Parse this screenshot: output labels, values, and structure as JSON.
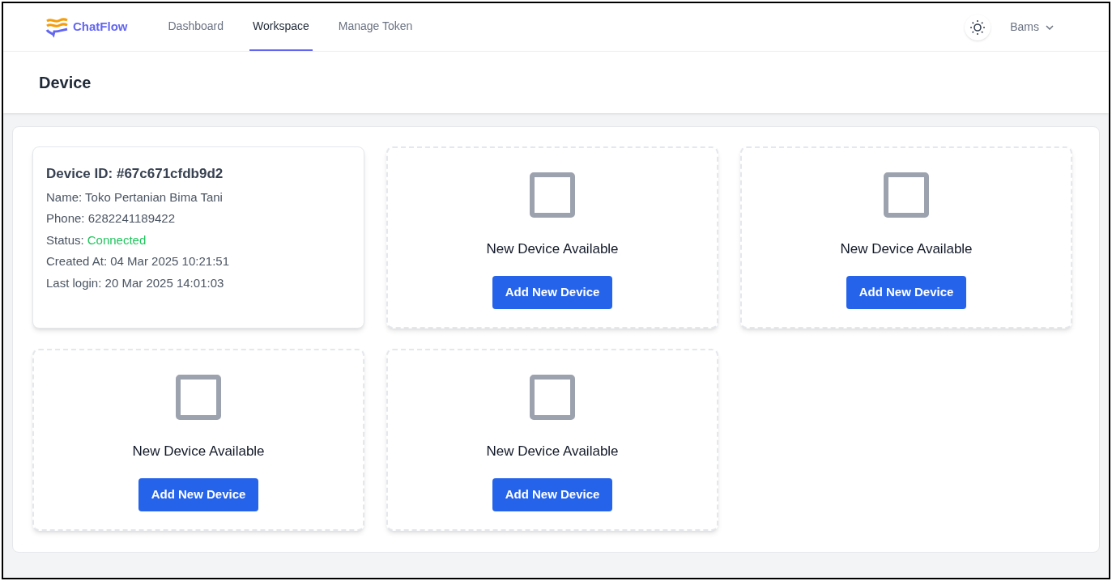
{
  "nav": {
    "brand": "ChatFlow",
    "links": [
      {
        "label": "Dashboard",
        "selected": false
      },
      {
        "label": "Workspace",
        "selected": true
      },
      {
        "label": "Manage Token",
        "selected": false
      }
    ],
    "user": "Bams"
  },
  "page_title": "Device",
  "devices": [
    {
      "kind": "device",
      "title": "Device ID: #67c671cfdb9d2",
      "lines": [
        "Name: Toko Pertanian Bima Tani",
        "Phone: 6282241189422"
      ],
      "status_label": "Status:",
      "status": "Connected",
      "connected": true,
      "more_lines": [
        "Created At: 04 Mar 2025 10:21:51",
        "Last login: 20 Mar 2025 14:01:03"
      ]
    },
    {
      "kind": "slot",
      "title": "New Device Available",
      "button": "Add New Device"
    },
    {
      "kind": "slot",
      "title": "New Device Available",
      "button": "Add New Device"
    },
    {
      "kind": "slot",
      "title": "New Device Available",
      "button": "Add New Device"
    },
    {
      "kind": "slot",
      "title": "New Device Available",
      "button": "Add New Device"
    }
  ]
}
